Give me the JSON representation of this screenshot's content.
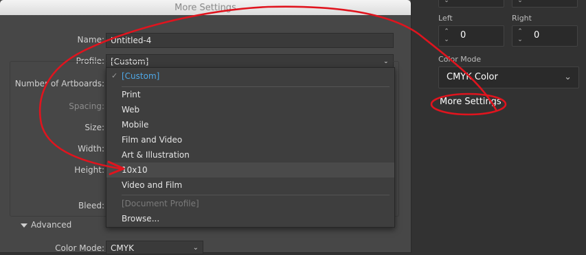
{
  "dialog": {
    "title": "More Settings",
    "name_label": "Name:",
    "name_value": "Untitled-4",
    "profile_label": "Profile:",
    "profile_value": "[Custom]",
    "artboards_label": "Number of Artboards:",
    "spacing_label": "Spacing:",
    "size_label": "Size:",
    "width_label": "Width:",
    "height_label": "Height:",
    "bleed_label": "Bleed:",
    "advanced_label": "Advanced",
    "color_mode_label": "Color Mode:",
    "color_mode_value": "CMYK"
  },
  "dropdown": {
    "selected": "[Custom]",
    "options_group1": [
      "Print",
      "Web",
      "Mobile",
      "Film and Video",
      "Art & Illustration"
    ],
    "highlighted": "10x10",
    "after_highlight": "Video and Film",
    "disabled_option": "[Document Profile]",
    "browse": "Browse..."
  },
  "panel": {
    "top_left_value": "0",
    "top_right_value": "0",
    "left_label": "Left",
    "left_value": "0",
    "right_label": "Right",
    "right_value": "0",
    "color_mode_label": "Color Mode",
    "color_mode_value": "CMYK Color",
    "more_settings": "More Settings"
  },
  "colors": {
    "annotation": "#e0141e",
    "selected_option": "#4fa9e8",
    "dialog_bg": "#474747",
    "panel_bg": "#323232"
  }
}
